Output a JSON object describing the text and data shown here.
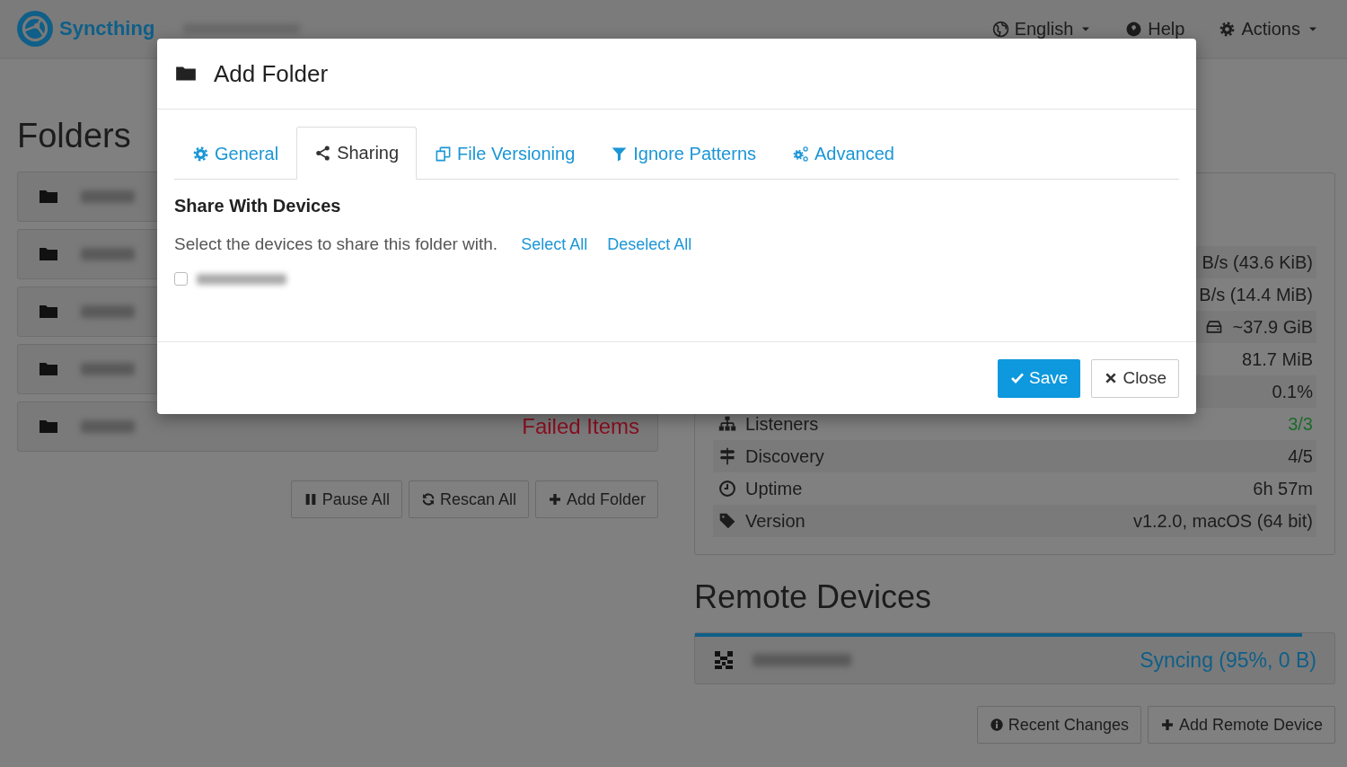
{
  "navbar": {
    "brand": "Syncthing",
    "menu": [
      {
        "label": "English",
        "dropdown": true
      },
      {
        "label": "Help",
        "dropdown": false
      },
      {
        "label": "Actions",
        "dropdown": true
      }
    ]
  },
  "folders": {
    "title": "Folders",
    "items": [
      {
        "kind": "folder"
      },
      {
        "kind": "folder"
      },
      {
        "kind": "folder"
      },
      {
        "kind": "folder"
      },
      {
        "kind": "folder",
        "status": "Failed Items"
      }
    ],
    "buttons": [
      {
        "label": "Pause All"
      },
      {
        "label": "Rescan All"
      },
      {
        "label": "Add Folder"
      }
    ]
  },
  "stats": [
    {
      "value": "B/s (43.6 KiB)",
      "color": "#1c1c1c"
    },
    {
      "value": "B/s (14.4 MiB)",
      "color": "#1c1c1c"
    },
    {
      "value": "~37.9 GiB",
      "color": "#1c1c1c"
    },
    {
      "value": "81.7 MiB",
      "color": "#1c1c1c"
    },
    {
      "value": "0.1%",
      "color": "#1c1c1c"
    },
    {
      "label": "Listeners",
      "value": "3/3",
      "color": "#1c6b2a"
    },
    {
      "label": "Discovery",
      "value": "4/5",
      "color": "#1c1c1c"
    },
    {
      "label": "Uptime",
      "value": "6h 57m",
      "color": "#1c1c1c"
    },
    {
      "label": "Version",
      "value": "v1.2.0, macOS (64 bit)",
      "color": "#1c1c1c"
    }
  ],
  "remote_devices": {
    "title": "Remote Devices",
    "items": [
      {
        "status": "Syncing (95%, 0 B)",
        "level": 0.95
      }
    ],
    "buttons": [
      {
        "label": "Recent Changes"
      },
      {
        "label": "Add Remote Device"
      }
    ]
  },
  "modal": {
    "title": "Add Folder",
    "tabs": [
      {
        "label": "General",
        "selected": false
      },
      {
        "label": "Sharing",
        "selected": true
      },
      {
        "label": "File Versioning",
        "selected": false
      },
      {
        "label": "Ignore Patterns",
        "selected": false
      },
      {
        "label": "Advanced",
        "selected": false
      }
    ],
    "section_title": "Share With Devices",
    "description": "Select the devices to share this folder with.",
    "links": [
      "Select All",
      "Deselect All"
    ],
    "devices": [
      {
        "checked": false
      }
    ],
    "buttons": [
      {
        "label": "Save",
        "kind": "primary"
      },
      {
        "label": "Close",
        "kind": "default"
      }
    ]
  }
}
